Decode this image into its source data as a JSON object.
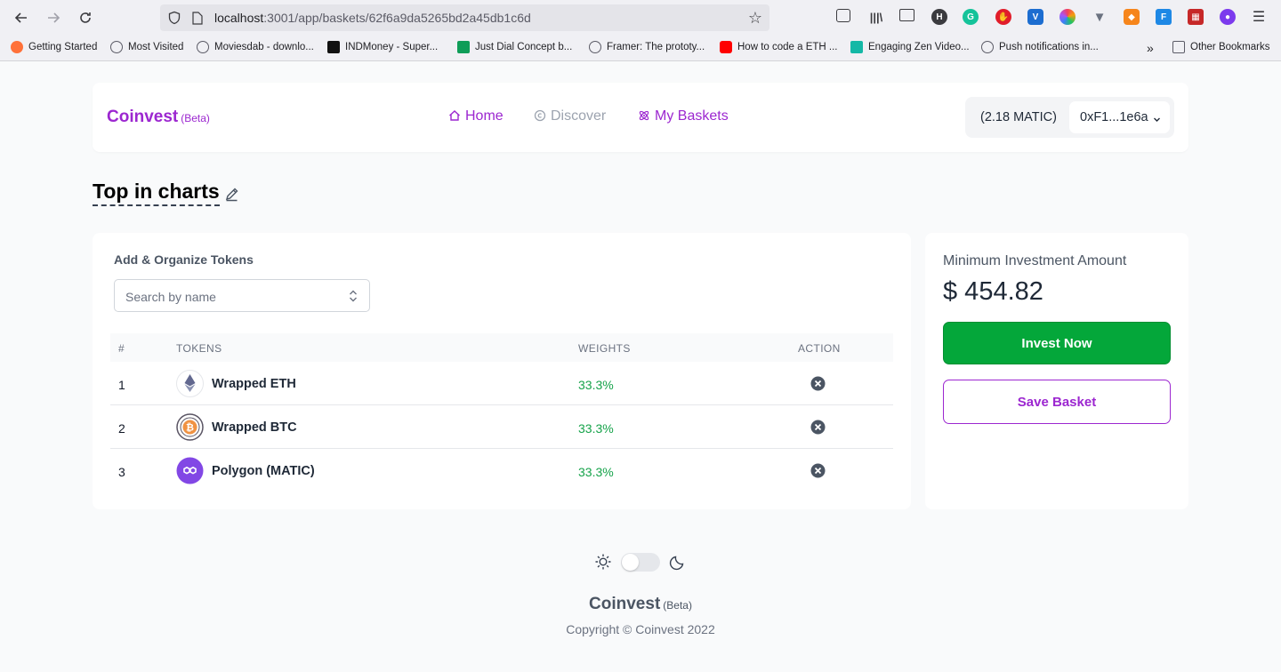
{
  "browser": {
    "url_host": "localhost",
    "url_rest": ":3001/app/baskets/62f6a9da5265bd2a45db1c6d",
    "bookmarks": [
      {
        "label": "Getting Started",
        "color": "#ff7139"
      },
      {
        "label": "Most Visited",
        "color": "#5b5b66"
      },
      {
        "label": "Moviesdab - downlo...",
        "color": "#5b5b66"
      },
      {
        "label": "INDMoney - Super...",
        "color": "#111111"
      },
      {
        "label": "Just Dial Concept b...",
        "color": "#0f9d58"
      },
      {
        "label": "Framer: The prototy...",
        "color": "#5b5b66"
      },
      {
        "label": "How to code a ETH ...",
        "color": "#ff0000"
      },
      {
        "label": "Engaging Zen Video...",
        "color": "#14b8a6"
      },
      {
        "label": "Push notifications in...",
        "color": "#5b5b66"
      }
    ],
    "other_bookmarks": "Other Bookmarks"
  },
  "app": {
    "brand": "Coinvest",
    "brand_tag": "(Beta)",
    "accent_color": "#9c27d0",
    "nav": {
      "home": "Home",
      "discover": "Discover",
      "baskets": "My Baskets"
    },
    "wallet": {
      "balance": "(2.18 MATIC)",
      "address": "0xF1...1e6a"
    }
  },
  "basket": {
    "title": "Top in charts",
    "section_label": "Add & Organize Tokens",
    "search_placeholder": "Search by name",
    "columns": [
      "#",
      "TOKENS",
      "WEIGHTS",
      "ACTION"
    ],
    "tokens": [
      {
        "num": "1",
        "name": "Wrapped ETH",
        "weight": "33.3%",
        "icon": "eth-icon"
      },
      {
        "num": "2",
        "name": "Wrapped BTC",
        "weight": "33.3%",
        "icon": "btc-icon"
      },
      {
        "num": "3",
        "name": "Polygon (MATIC)",
        "weight": "33.3%",
        "icon": "matic-icon"
      }
    ]
  },
  "invest": {
    "min_label": "Minimum Investment Amount",
    "min_value": "$ 454.82",
    "invest_button": "Invest Now",
    "save_button": "Save Basket"
  },
  "footer": {
    "brand": "Coinvest",
    "brand_tag": "(Beta)",
    "copyright": "Copyright © Coinvest 2022"
  }
}
